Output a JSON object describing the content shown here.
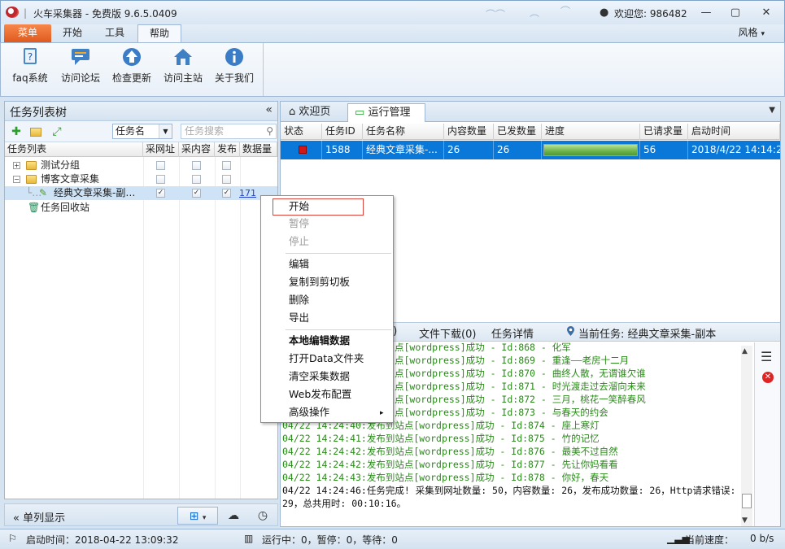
{
  "window": {
    "app_title": "火车采集器 - 免费版 9.6.5.0409",
    "welcome": "欢迎您: 986482",
    "controls": [
      "—",
      "▢",
      "✕"
    ]
  },
  "ribbon": {
    "tabs": [
      "菜单",
      "开始",
      "工具",
      "帮助"
    ],
    "style_label": "风格",
    "buttons": [
      "faq系统",
      "访问论坛",
      "检查更新",
      "访问主站",
      "关于我们"
    ]
  },
  "left": {
    "title": "任务列表树",
    "collapse_glyph": "«",
    "search_select": "任务名",
    "search_placeholder": "任务搜索",
    "columns": [
      "任务列表",
      "采网址",
      "采内容",
      "发布",
      "数据量"
    ],
    "tree": [
      {
        "label": "测试分组",
        "expander": "+"
      },
      {
        "label": "博客文章采集",
        "expander": "−"
      },
      {
        "label": "经典文章采集-副…",
        "count": "171"
      },
      {
        "label": "任务回收站"
      }
    ],
    "footer_label": "单列显示"
  },
  "right": {
    "tabs": [
      "欢迎页",
      "运行管理"
    ],
    "columns": [
      "状态",
      "任务ID",
      "任务名称",
      "内容数量",
      "已发数量",
      "进度",
      "已请求量",
      "启动时间"
    ],
    "row": {
      "id": "1588",
      "name": "经典文章采集-...",
      "content_count": "26",
      "sent_count": "26",
      "progress": 1.0,
      "requested": "56",
      "start_time": "2018/4/22 14:14:29"
    },
    "log_tabs": [
      "3)",
      "文件下载(0)",
      "任务详情"
    ],
    "current_task": "当前任务: 经典文章采集-副本"
  },
  "log": [
    {
      "text": "点[wordpress]成功 - Id:868 - 化军",
      "color": "green"
    },
    {
      "text": "点[wordpress]成功 - Id:869 - 重逢——老房十二月",
      "color": "green"
    },
    {
      "text": "点[wordpress]成功 - Id:870 - 曲终人散，无谓谁欠谁",
      "color": "green"
    },
    {
      "text": "点[wordpress]成功 - Id:871 - 时光渡走过去溜向未来",
      "color": "green"
    },
    {
      "text": "点[wordpress]成功 - Id:872 - 三月，桃花一笑醉春风",
      "color": "green"
    },
    {
      "text": "点[wordpress]成功 - Id:873 - 与春天的约会",
      "color": "green"
    },
    {
      "text": "04/22 14:24:40:发布到站点[wordpress]成功 - Id:874 - 座上寒灯",
      "color": "green"
    },
    {
      "text": "04/22 14:24:41:发布到站点[wordpress]成功 - Id:875 - 竹的记忆",
      "color": "green"
    },
    {
      "text": "04/22 14:24:42:发布到站点[wordpress]成功 - Id:876 - 最美不过自然",
      "color": "green"
    },
    {
      "text": "04/22 14:24:42:发布到站点[wordpress]成功 - Id:877 - 先让你妈看看",
      "color": "green"
    },
    {
      "text": "04/22 14:24:43:发布到站点[wordpress]成功 - Id:878 - 你好，春天",
      "color": "green"
    },
    {
      "text": "04/22 14:24:46:任务完成! 采集到网址数量: 50，内容数量: 26，发布成功数量: 26，Http请求错误:",
      "color": "black"
    },
    {
      "text": "29，总共用时: 00:10:16。",
      "color": "black"
    }
  ],
  "context_menu": {
    "items": [
      {
        "label": "开始",
        "disabled": false,
        "bold": false
      },
      {
        "label": "暂停",
        "disabled": true,
        "bold": false
      },
      {
        "label": "停止",
        "disabled": true,
        "bold": false
      },
      {
        "label": "编辑",
        "disabled": false,
        "bold": false
      },
      {
        "label": "复制到剪切板",
        "disabled": false,
        "bold": false
      },
      {
        "label": "删除",
        "disabled": false,
        "bold": false
      },
      {
        "label": "导出",
        "disabled": false,
        "bold": false
      },
      {
        "label": "本地编辑数据",
        "disabled": false,
        "bold": true
      },
      {
        "label": "打开Data文件夹",
        "disabled": false,
        "bold": false
      },
      {
        "label": "清空采集数据",
        "disabled": false,
        "bold": false
      },
      {
        "label": "Web发布配置",
        "disabled": false,
        "bold": false
      },
      {
        "label": "高级操作",
        "disabled": false,
        "bold": false
      }
    ],
    "submenu_arrow": "▸"
  },
  "status": {
    "start_time": "启动时间：2018-04-22 13:09:32",
    "running": "运行中：0，暂停：0，等待：0",
    "speed_label": "当前速度：",
    "speed_value": "0 b/s"
  },
  "colors": {
    "accent_orange": "#e05a1e",
    "selection_blue": "#0a78d8",
    "log_green": "#2a8a1a",
    "highlight_red": "#d9443b"
  }
}
